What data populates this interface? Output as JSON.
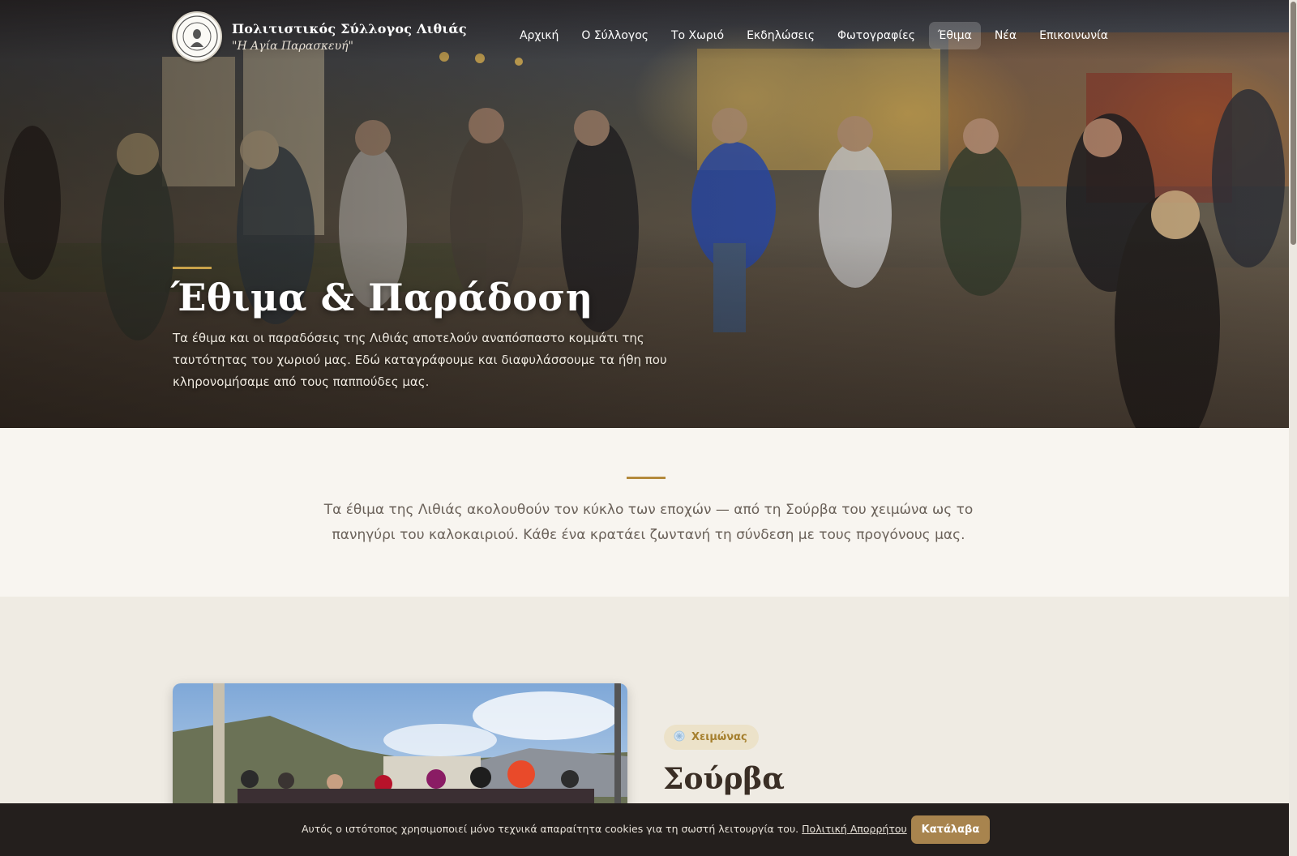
{
  "site": {
    "title": "Πολιτιστικός Σύλλογος Λιθιάς",
    "subtitle": "\"Η Αγία Παρασκευή\""
  },
  "nav": {
    "items": [
      {
        "label": "Αρχική",
        "active": false
      },
      {
        "label": "Ο Σύλλογος",
        "active": false
      },
      {
        "label": "Το Χωριό",
        "active": false
      },
      {
        "label": "Εκδηλώσεις",
        "active": false
      },
      {
        "label": "Φωτογραφίες",
        "active": false
      },
      {
        "label": "Έθιμα",
        "active": true
      },
      {
        "label": "Νέα",
        "active": false
      },
      {
        "label": "Επικοινωνία",
        "active": false
      }
    ]
  },
  "hero": {
    "title": "Έθιμα & Παράδοση",
    "description": "Τα έθιμα και οι παραδόσεις της Λιθιάς αποτελούν αναπόσπαστο κομμάτι της ταυτότητας του χωριού μας. Εδώ καταγράφουμε και διαφυλάσσουμε τα ήθη που κληρονομήσαμε από τους παππούδες μας."
  },
  "intro": {
    "text": "Τα έθιμα της Λιθιάς ακολουθούν τον κύκλο των εποχών — από τη Σούρβα του χειμώνα ως το πανηγύρι του καλοκαιριού. Κάθε ένα κρατάει ζωντανή τη σύνδεση με τους προγόνους μας."
  },
  "custom": {
    "season": "Χειμώνας",
    "season_icon": "snowflake-icon",
    "title": "Σούρβα"
  },
  "cookie": {
    "text": "Αυτός ο ιστότοπος χρησιμοποιεί μόνο τεχνικά απαραίτητα cookies για τη σωστή λειτουργία του.",
    "link": "Πολιτική Απορρήτου",
    "button": "Κατάλαβα"
  },
  "colors": {
    "accent_gold": "#c9a24a",
    "cookie_button": "#a8844e",
    "page_bg": "#f8f5f0",
    "section_bg": "#efebe3",
    "heading": "#3a2e25"
  }
}
